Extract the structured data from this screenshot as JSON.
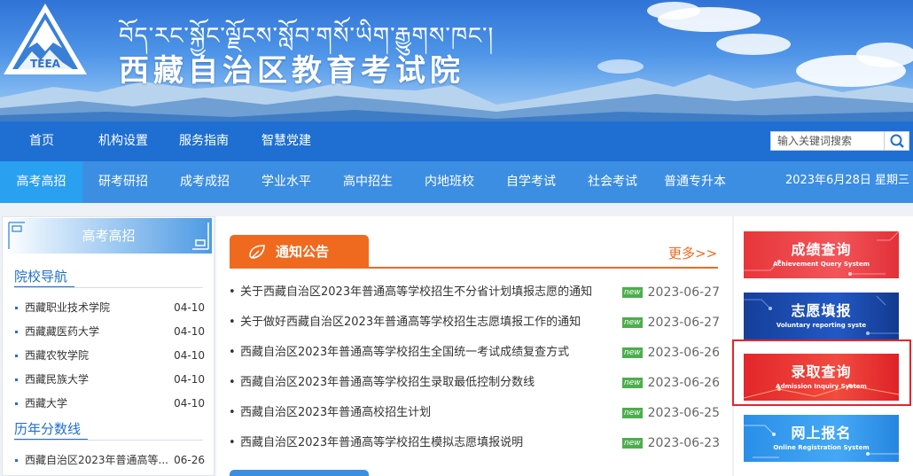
{
  "header": {
    "tibetan_title": "བོད་རང་སྐྱོང་ལྗོངས་སློབ་གསོ་ཡིག་རྒྱུགས་ཁང་།",
    "site_title": "西藏自治区教育考试院",
    "logo_text": "TEEA"
  },
  "nav_primary": {
    "items": [
      "首页",
      "机构设置",
      "服务指南",
      "智慧党建"
    ]
  },
  "search": {
    "placeholder": "输入关键词搜索"
  },
  "nav_secondary": {
    "items": [
      "高考高招",
      "研考研招",
      "成考成招",
      "学业水平",
      "高中招生",
      "内地班校",
      "自学考试",
      "社会考试",
      "普通专升本"
    ],
    "active_index": 0,
    "date": "2023年6月28日 星期三"
  },
  "left_panel": {
    "title": "高考高招",
    "section1_title": "院校导航",
    "section1_items": [
      {
        "name": "西藏职业技术学院",
        "date": "04-10"
      },
      {
        "name": "西藏藏医药大学",
        "date": "04-10"
      },
      {
        "name": "西藏农牧学院",
        "date": "04-10"
      },
      {
        "name": "西藏民族大学",
        "date": "04-10"
      },
      {
        "name": "西藏大学",
        "date": "04-10"
      }
    ],
    "section2_title": "历年分数线",
    "section2_items": [
      {
        "name": "西藏自治区2023年普通高等...",
        "date": "06-26"
      }
    ]
  },
  "notice": {
    "title": "通知公告",
    "more": "更多>>",
    "badge": "new",
    "items": [
      {
        "title": "关于西藏自治区2023年普通高等学校招生不分省计划填报志愿的通知",
        "date": "2023-06-27"
      },
      {
        "title": "关于做好西藏自治区2023年普通高等学校招生志愿填报工作的通知",
        "date": "2023-06-27"
      },
      {
        "title": "西藏自治区2023年普通高等学校招生全国统一考试成绩复查方式",
        "date": "2023-06-26"
      },
      {
        "title": "西藏自治区2023年普通高等学校招生录取最低控制分数线",
        "date": "2023-06-26"
      },
      {
        "title": "西藏自治区2023年普通高校招生计划",
        "date": "2023-06-25"
      },
      {
        "title": "西藏自治区2023年普通高等学校招生模拟志愿填报说明",
        "date": "2023-06-23"
      }
    ]
  },
  "quick_links": [
    {
      "cn": "成绩查询",
      "en": "Achievement Query System",
      "color": "#e8303a"
    },
    {
      "cn": "志愿填报",
      "en": "Voluntary reporting syste",
      "color": "#1c4fb0"
    },
    {
      "cn": "录取查询",
      "en": "Admission Inquiry System",
      "color": "#e3262b"
    },
    {
      "cn": "网上报名",
      "en": "Online Registration System",
      "color": "#2a8fe8"
    }
  ]
}
